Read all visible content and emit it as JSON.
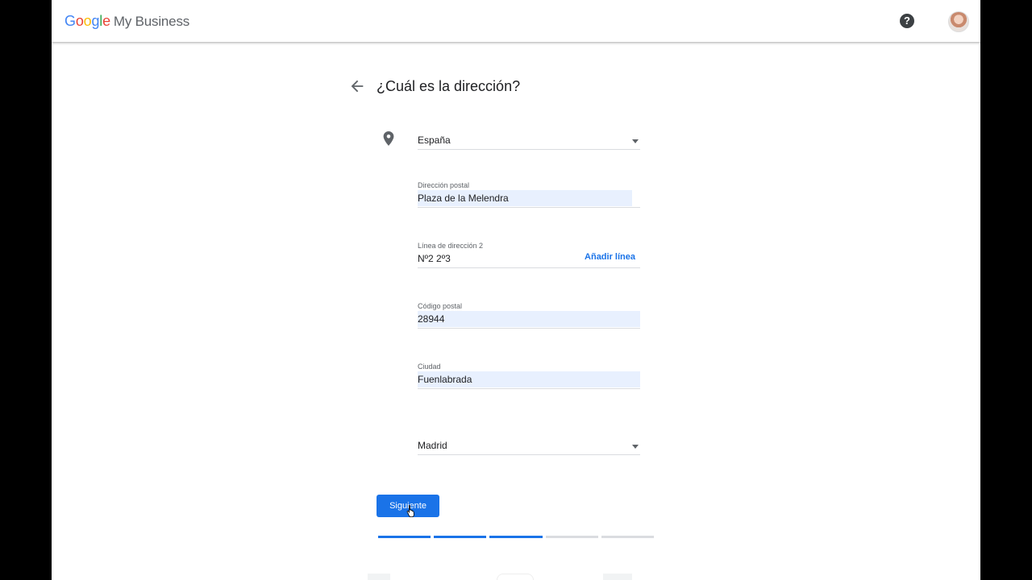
{
  "header": {
    "logo_google": [
      "G",
      "o",
      "o",
      "g",
      "l",
      "e"
    ],
    "logo_product": "My Business",
    "help_icon": "?"
  },
  "page": {
    "title": "¿Cuál es la dirección?"
  },
  "form": {
    "country": {
      "value": "España"
    },
    "street": {
      "label": "Dirección postal",
      "value": "Plaza de la Melendra"
    },
    "line2": {
      "label": "Línea de dirección 2",
      "value": "Nº2 2º3",
      "add_line": "Añadir línea"
    },
    "postal_code": {
      "label": "Código postal",
      "value": "28944"
    },
    "city": {
      "label": "Ciudad",
      "value": "Fuenlabrada"
    },
    "province": {
      "value": "Madrid"
    }
  },
  "actions": {
    "next_label": "Siguiente"
  },
  "progress": {
    "steps_total": 5,
    "steps_done": 3
  },
  "colors": {
    "accent": "#1a73e8",
    "autofill": "#e8f0fe"
  }
}
